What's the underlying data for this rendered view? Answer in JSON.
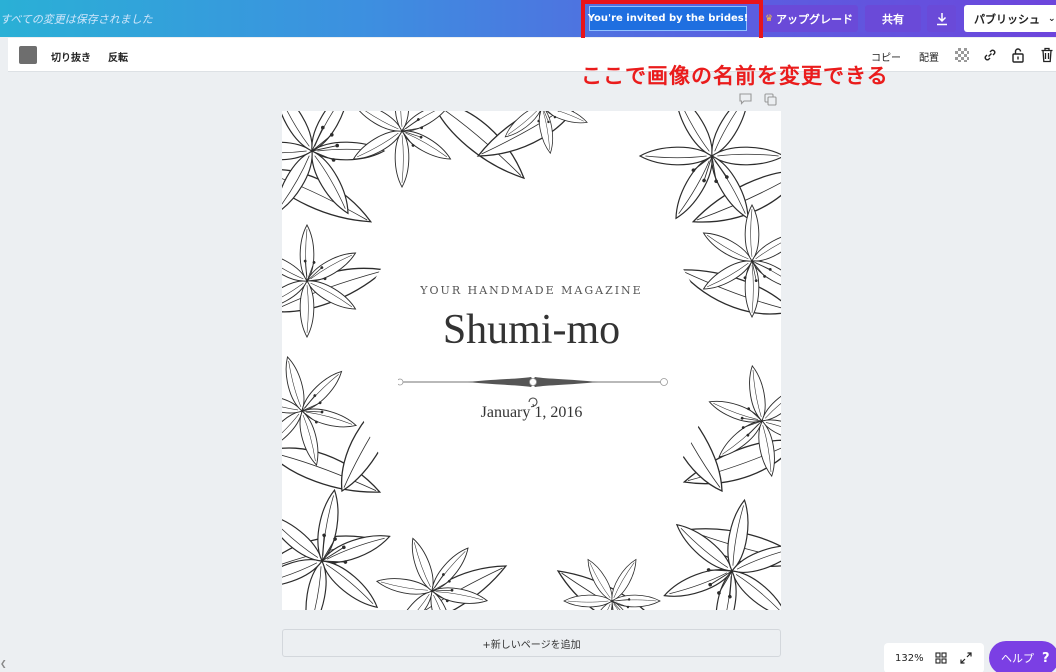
{
  "topbar": {
    "save_status": "すべての変更は保存されました",
    "design_title": "You're invited by the brides!",
    "upgrade_label": "アップグレード",
    "share_label": "共有",
    "publish_label": "パブリッシュ"
  },
  "toolbar": {
    "swatch_color": "#6e6e6e",
    "crop_label": "切り抜き",
    "flip_label": "反転",
    "copy_label": "コピー",
    "arrange_label": "配置"
  },
  "annotation": {
    "text": "ここで画像の名前を変更できる",
    "color": "#ea1c1c"
  },
  "canvas": {
    "tagline": "YOUR HANDMADE MAGAZINE",
    "title": "Shumi-mo",
    "date": "January 1, 2016"
  },
  "add_page_label": "+新しいページを追加",
  "zoom_level": "132%",
  "help_label": "ヘルプ",
  "help_symbol": "?",
  "colors": {
    "accent_purple": "#6a4ad8",
    "help_purple": "#7b3fe4",
    "title_button_blue": "#1f6fe0"
  }
}
